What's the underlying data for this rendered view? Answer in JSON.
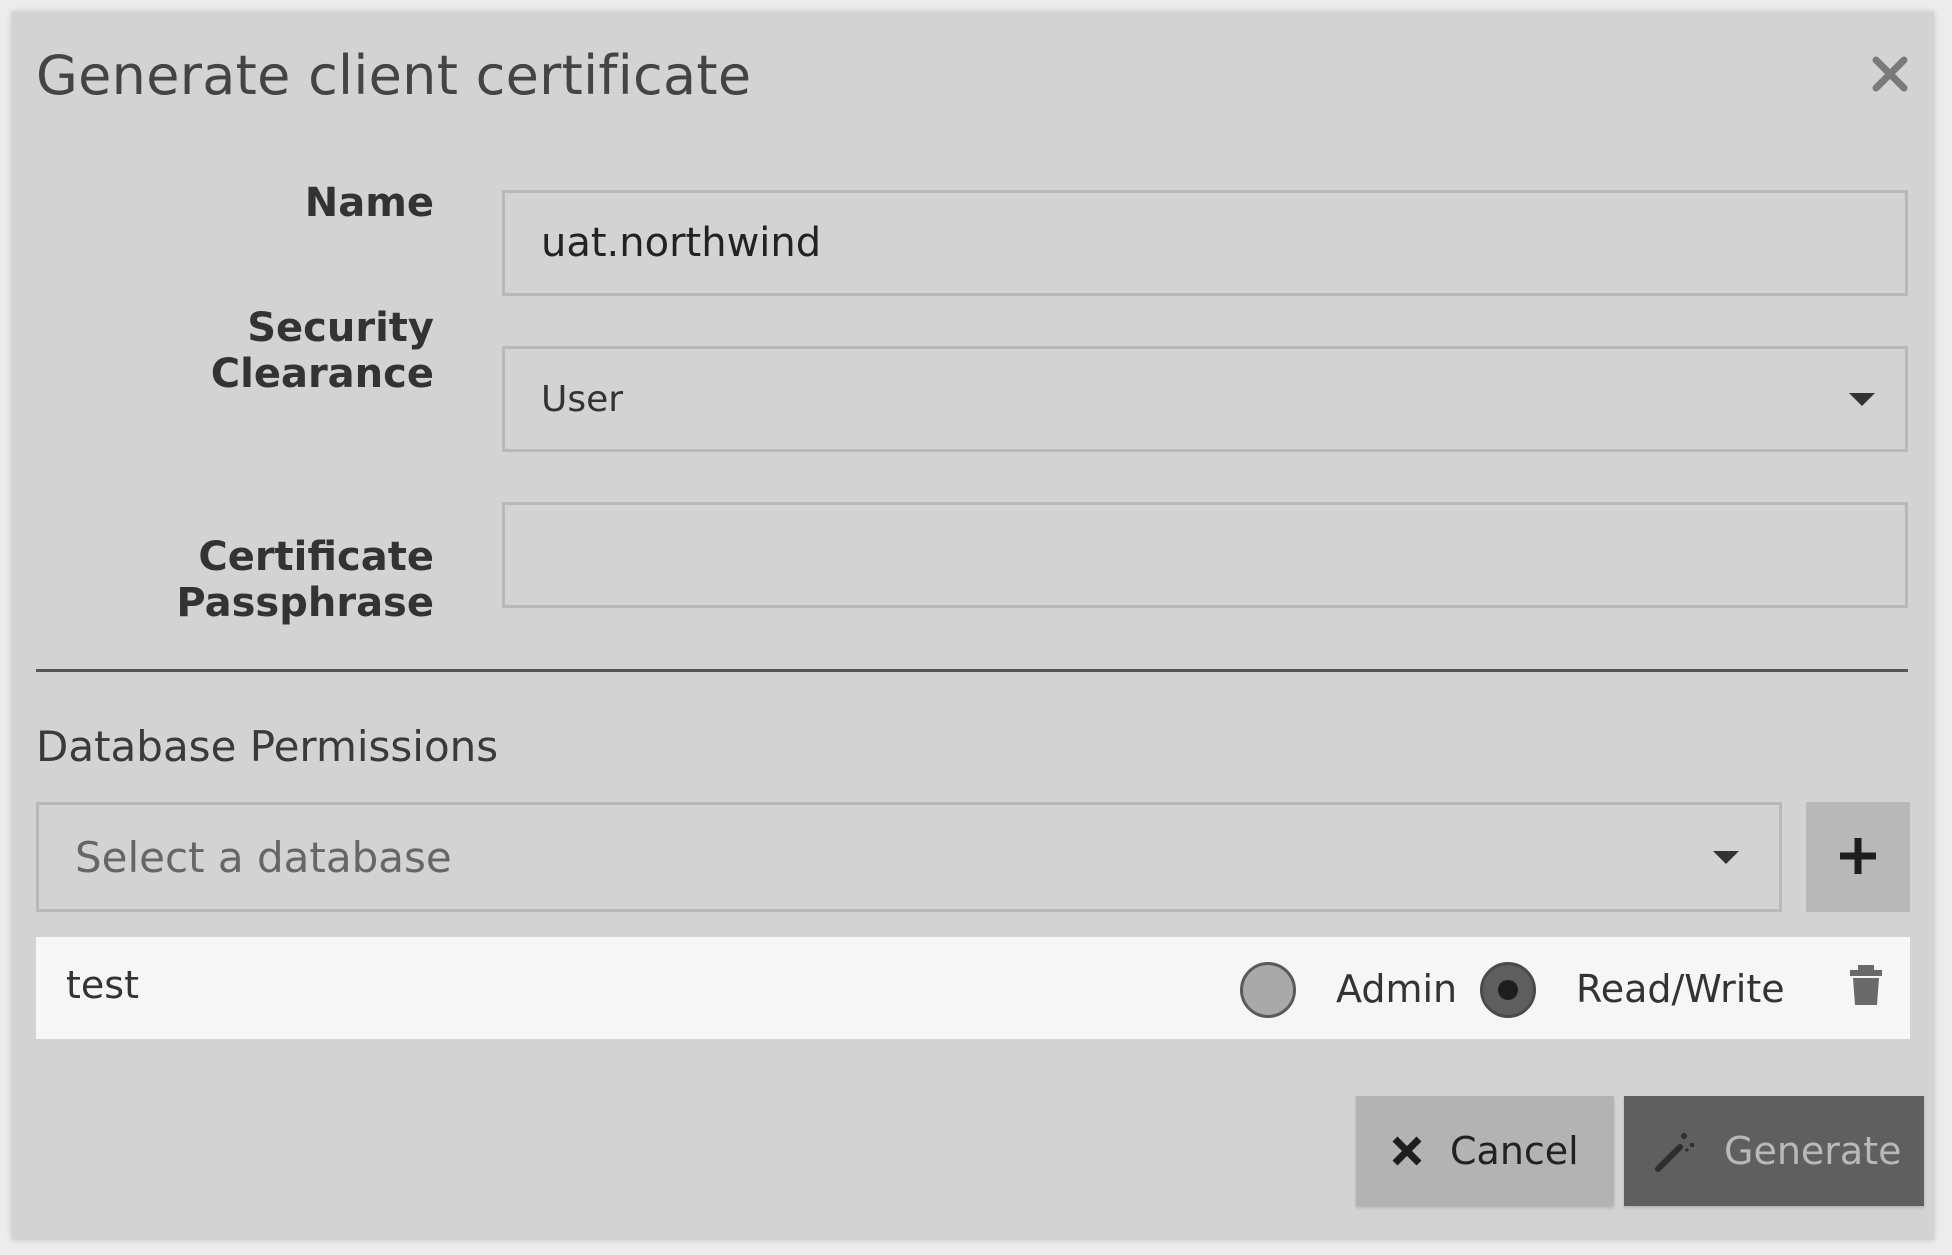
{
  "dialog": {
    "title": "Generate client certificate",
    "close_icon": "close-icon"
  },
  "form": {
    "name_label": "Name",
    "name_value": "uat.northwind",
    "clearance_label": "Security Clearance",
    "clearance_value": "User",
    "passphrase_label_line1": "Certificate",
    "passphrase_label_line2": "Passphrase",
    "passphrase_value": ""
  },
  "permissions": {
    "section_title": "Database Permissions",
    "select_placeholder": "Select a database",
    "add_icon": "plus-icon",
    "rows": [
      {
        "database": "test",
        "options": [
          "Admin",
          "Read/Write"
        ],
        "selected": "Read/Write",
        "delete_icon": "trash-icon"
      }
    ]
  },
  "actions": {
    "cancel_label": "Cancel",
    "cancel_icon": "close-icon",
    "generate_label": "Generate",
    "generate_icon": "magic-wand-icon"
  },
  "colors": {
    "dialog_bg": "#d3d3d3",
    "row_bg": "#f6f6f6",
    "generate_bg": "#5f5f5f",
    "cancel_bg": "#b3b3b3"
  }
}
